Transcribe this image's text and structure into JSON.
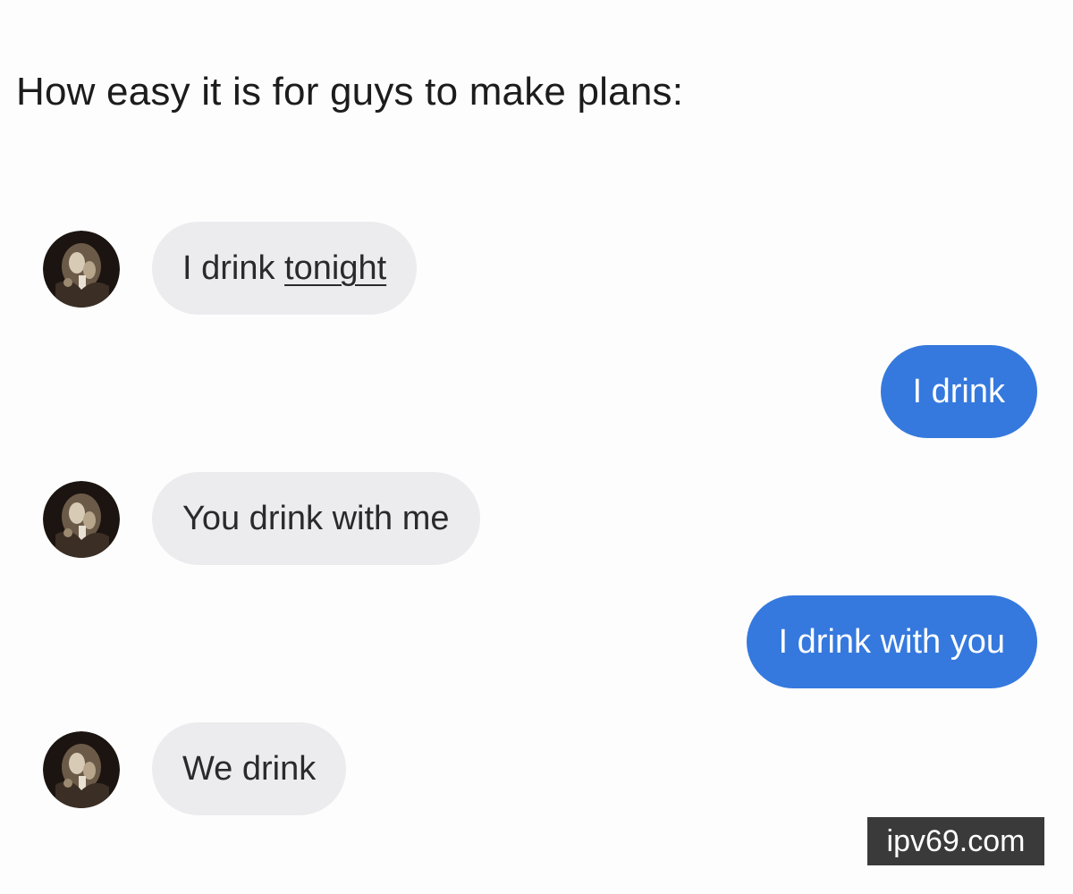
{
  "caption": "How easy it is for guys to make plans:",
  "messages": [
    {
      "parts": [
        "I drink ",
        "tonight"
      ]
    },
    {
      "text": "I drink"
    },
    {
      "text": "You drink with me"
    },
    {
      "text": "I drink with you"
    },
    {
      "text": "We drink"
    }
  ],
  "colors": {
    "incoming_bubble": "#ecebee",
    "outgoing_bubble": "#3579de",
    "watermark_bg": "#3a3a3a"
  },
  "watermark": "ipv69.com",
  "avatar_icon": "profile-photo-icon"
}
